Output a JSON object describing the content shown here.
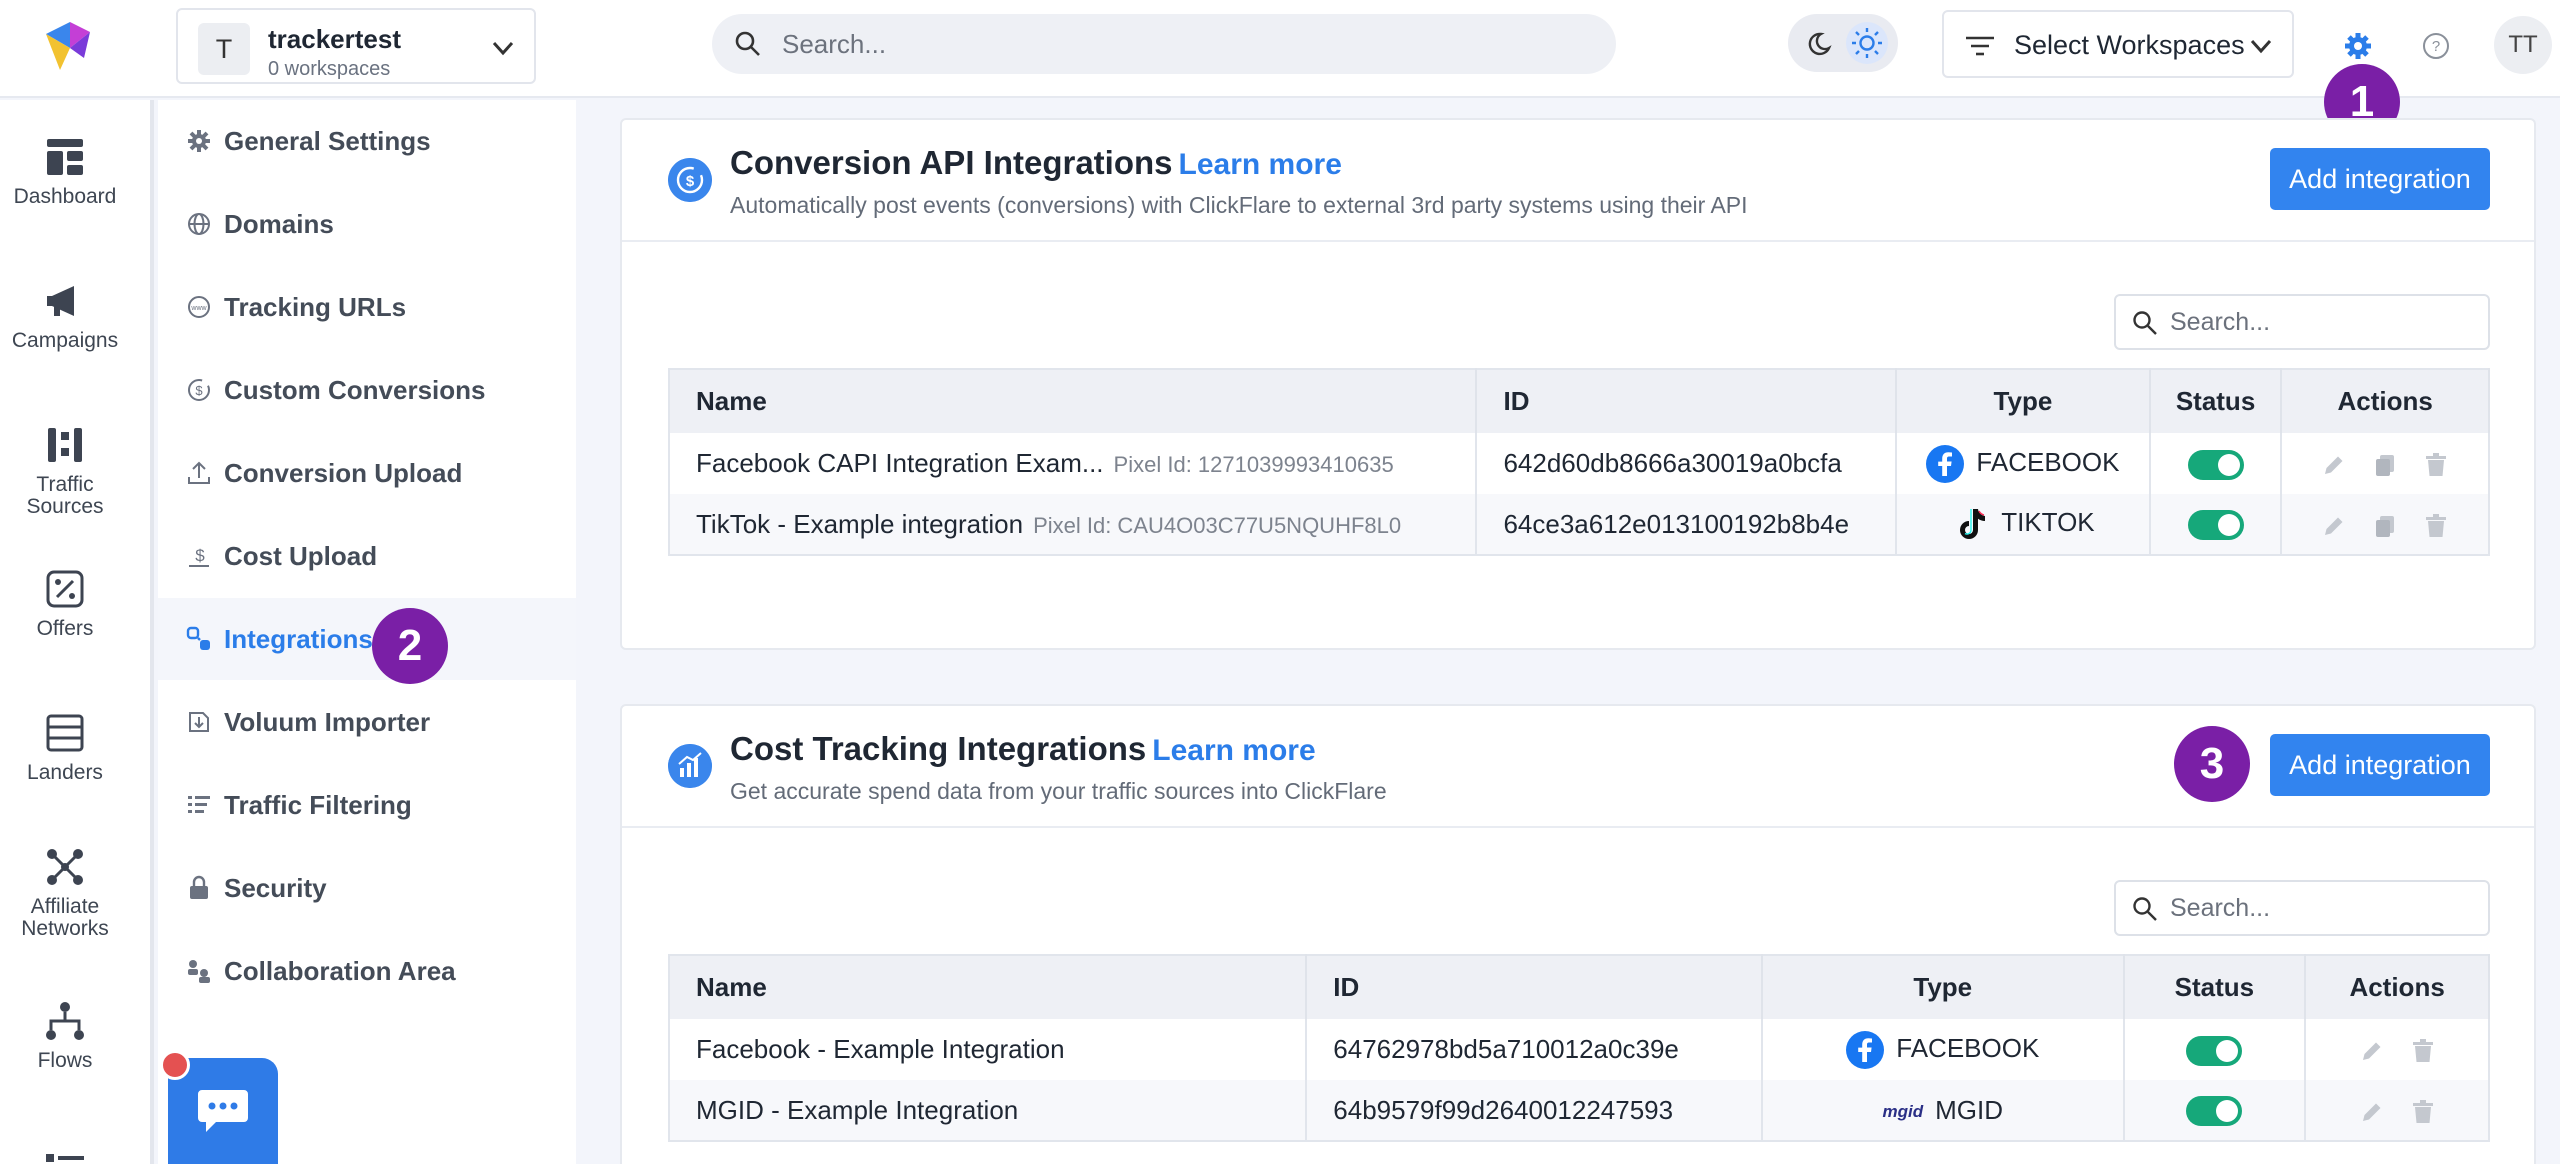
{
  "workspace": {
    "avatar": "T",
    "name": "trackertest",
    "subtitle": "0 workspaces"
  },
  "search": {
    "placeholder": "Search..."
  },
  "header": {
    "select_workspaces": "Select Workspaces",
    "user_initials": "TT"
  },
  "colors": {
    "accent": "#3284ef",
    "badge": "#7a1fa6",
    "toggle_on": "#16a87a",
    "active_text": "#2b7de9"
  },
  "rail": [
    {
      "label": "Dashboard",
      "icon": "dashboard-icon"
    },
    {
      "label": "Campaigns",
      "icon": "megaphone-icon"
    },
    {
      "label": "Traffic Sources",
      "icon": "traffic-sources-icon"
    },
    {
      "label": "Offers",
      "icon": "offers-icon"
    },
    {
      "label": "Landers",
      "icon": "landers-icon"
    },
    {
      "label": "Affiliate\nNetworks",
      "icon": "network-icon"
    },
    {
      "label": "Flows",
      "icon": "flows-icon"
    }
  ],
  "submenu": [
    {
      "label": "General Settings",
      "icon": "gear-icon"
    },
    {
      "label": "Domains",
      "icon": "globe-icon"
    },
    {
      "label": "Tracking URLs",
      "icon": "www-icon"
    },
    {
      "label": "Custom Conversions",
      "icon": "dollar-cycle-icon"
    },
    {
      "label": "Conversion Upload",
      "icon": "upload-icon"
    },
    {
      "label": "Cost Upload",
      "icon": "cost-icon"
    },
    {
      "label": "Integrations",
      "icon": "integrations-icon",
      "active": true
    },
    {
      "label": "Voluum Importer",
      "icon": "importer-icon"
    },
    {
      "label": "Traffic Filtering",
      "icon": "filter-list-icon"
    },
    {
      "label": "Security",
      "icon": "lock-icon"
    },
    {
      "label": "Collaboration Area",
      "icon": "collaboration-icon"
    }
  ],
  "badges": {
    "one": "1",
    "two": "2",
    "three": "3"
  },
  "conversion_api": {
    "title": "Conversion API Integrations",
    "learn_more": "Learn more",
    "description": "Automatically post events (conversions) with ClickFlare to external 3rd party systems using their API",
    "add_button": "Add integration",
    "search_placeholder": "Search...",
    "columns": [
      "Name",
      "ID",
      "Type",
      "Status",
      "Actions"
    ],
    "rows": [
      {
        "name": "Facebook CAPI Integration Exam...",
        "pixel": "Pixel Id: 1271039993410635",
        "id": "642d60db8666a30019a0bcfa",
        "type": "FACEBOOK"
      },
      {
        "name": "TikTok - Example integration",
        "pixel": "Pixel Id: CAU4O03C77U5NQUHF8L0",
        "id": "64ce3a612e013100192b8b4e",
        "type": "TIKTOK"
      }
    ]
  },
  "cost_tracking": {
    "title": "Cost Tracking Integrations",
    "learn_more": "Learn more",
    "description": "Get accurate spend data from your traffic sources into ClickFlare",
    "add_button": "Add integration",
    "search_placeholder": "Search...",
    "columns": [
      "Name",
      "ID",
      "Type",
      "Status",
      "Actions"
    ],
    "mgid_logo": "mgid",
    "rows": [
      {
        "name": "Facebook - Example Integration",
        "id": "64762978bd5a710012a0c39e",
        "type": "FACEBOOK"
      },
      {
        "name": "MGID - Example Integration",
        "id": "64b9579f99d2640012247593",
        "type": "MGID"
      }
    ]
  }
}
